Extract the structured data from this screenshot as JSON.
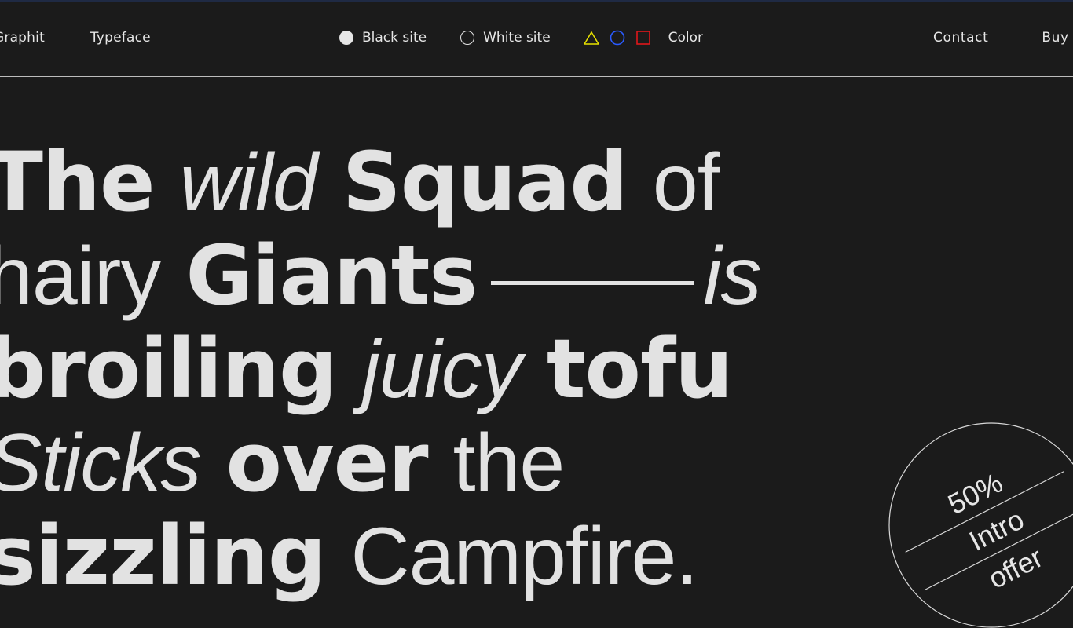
{
  "nav": {
    "brand": "Graphit",
    "typeface": "Typeface",
    "black_site": "Black site",
    "white_site": "White site",
    "color": "Color",
    "contact": "Contact",
    "buy": "Buy"
  },
  "headline": {
    "w1": "The",
    "w2": "wild",
    "w3": "Squad",
    "w4": "of",
    "w5": "hairy",
    "w6": "Giants",
    "w7": "is",
    "w8": "broiling",
    "w9": "juicy",
    "w10": "tofu",
    "w11": "Sticks",
    "w12": "over",
    "w13": "the",
    "w14": "sizzling",
    "w15": "Campfire."
  },
  "badge": {
    "line1": "50%",
    "line2": "Intro",
    "line3": "offer"
  },
  "colors": {
    "triangle": "#e8e100",
    "circle": "#2a5bff",
    "square": "#e0171b",
    "background": "#1b1b1b",
    "text": "#e2e2e2"
  }
}
